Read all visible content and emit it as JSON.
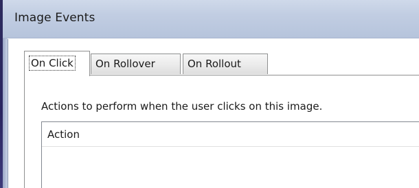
{
  "window": {
    "title": "Image Events"
  },
  "tabs": [
    {
      "label": "On Click",
      "selected": true
    },
    {
      "label": "On Rollover",
      "selected": false
    },
    {
      "label": "On Rollout",
      "selected": false
    }
  ],
  "panel": {
    "description": "Actions to perform when the user clicks on this image.",
    "list": {
      "columns": [
        "Action"
      ],
      "rows": []
    }
  },
  "colors": {
    "titlebar": "#c1cde2",
    "frame_dark": "#2d2b5e",
    "tab_border": "#8e8f8f",
    "text": "#1a1a1a"
  }
}
